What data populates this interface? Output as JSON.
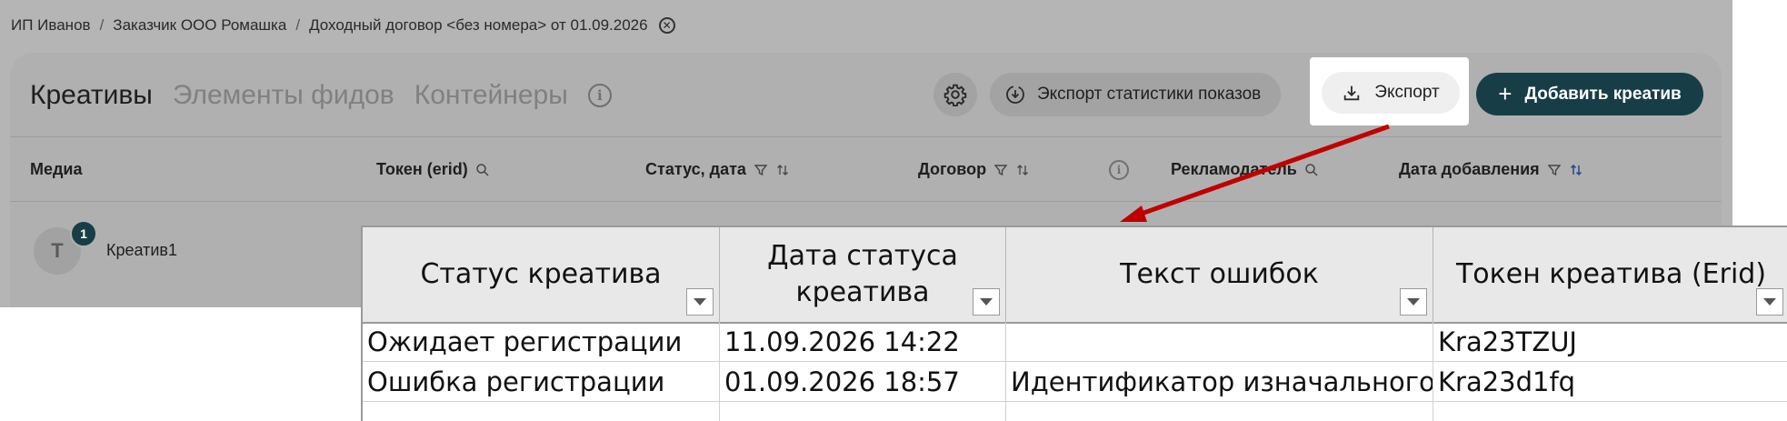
{
  "breadcrumb": {
    "items": [
      "ИП Иванов",
      "Заказчик ООО Ромашка",
      "Доходный договор <без номера> от 01.09.2026"
    ],
    "separator": "/"
  },
  "tabs": [
    {
      "label": "Креативы",
      "active": true
    },
    {
      "label": "Элементы фидов",
      "active": false
    },
    {
      "label": "Контейнеры",
      "active": false
    }
  ],
  "toolbar": {
    "settings_icon": "gear-icon",
    "stats_export_label": "Экспорт статистики показов",
    "export_label": "Экспорт",
    "add_label": "Добавить креатив"
  },
  "table": {
    "columns": [
      "Медиа",
      "Токен (erid)",
      "Статус, дата",
      "Договор",
      "Рекламодатель",
      "Дата добавления"
    ],
    "rows": [
      {
        "avatar_letter": "Т",
        "badge": "1",
        "name": "Креатив1"
      }
    ]
  },
  "spreadsheet": {
    "headers": [
      "Статус креатива",
      "Дата статуса креатива",
      "Текст ошибок",
      "Токен креатива (Erid)"
    ],
    "rows": [
      [
        "Ожидает регистрации",
        "11.09.2026 14:22",
        "",
        "Kra23TZUJ"
      ],
      [
        "Ошибка регистрации",
        "01.09.2026 18:57",
        "Идентификатор изначального д",
        "Kra23d1fq"
      ],
      [
        "",
        "",
        "",
        ""
      ]
    ]
  },
  "colors": {
    "primary": "#173e46",
    "annotation_arrow": "#c00000",
    "overlay_bg": "#b5b5b5"
  }
}
